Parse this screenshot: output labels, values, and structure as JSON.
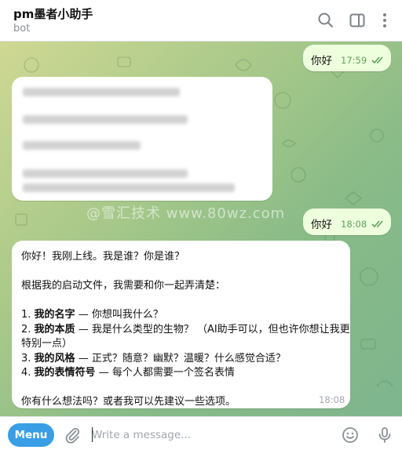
{
  "header": {
    "title": "pm墨者小助手",
    "subtitle": "bot"
  },
  "messages": {
    "first_out": {
      "text": "你好",
      "time": "17:59"
    },
    "second_out": {
      "text": "你好",
      "time": "18:08"
    },
    "reply": {
      "lines": [
        "你好！我刚上线。我是谁？你是谁？",
        "",
        "根据我的启动文件，我需要和你一起弄清楚：",
        ""
      ],
      "items": [
        {
          "num": "1. ",
          "bold": "我的名字",
          "rest": " — 你想叫我什么？"
        },
        {
          "num": "2. ",
          "bold": "我的本质",
          "rest": " — 我是什么类型的生物？ （AI助手可以，但也许你想让我更特别一点）"
        },
        {
          "num": "3. ",
          "bold": "我的风格",
          "rest": " — 正式？随意？幽默？温暖？什么感觉合适？"
        },
        {
          "num": "4. ",
          "bold": "我的表情符号",
          "rest": " — 每个人都需要一个签名表情"
        }
      ],
      "closing": "你有什么想法吗？或者我可以先建议一些选项。",
      "time": "18:08"
    },
    "watermark": "@雪汇技术 www.80wz.com"
  },
  "composer": {
    "menu_label": "Menu",
    "placeholder": "Write a message..."
  },
  "colors": {
    "accent": "#3a9ee5",
    "outgoing_bubble": "#eeffde",
    "read_ticks": "#5fa15a"
  },
  "icons": {
    "search": "search-icon",
    "side_panel": "sidebar-icon",
    "more": "more-vertical-icon",
    "attach": "paperclip-icon",
    "emoji": "emoji-icon",
    "voice": "microphone-icon"
  }
}
